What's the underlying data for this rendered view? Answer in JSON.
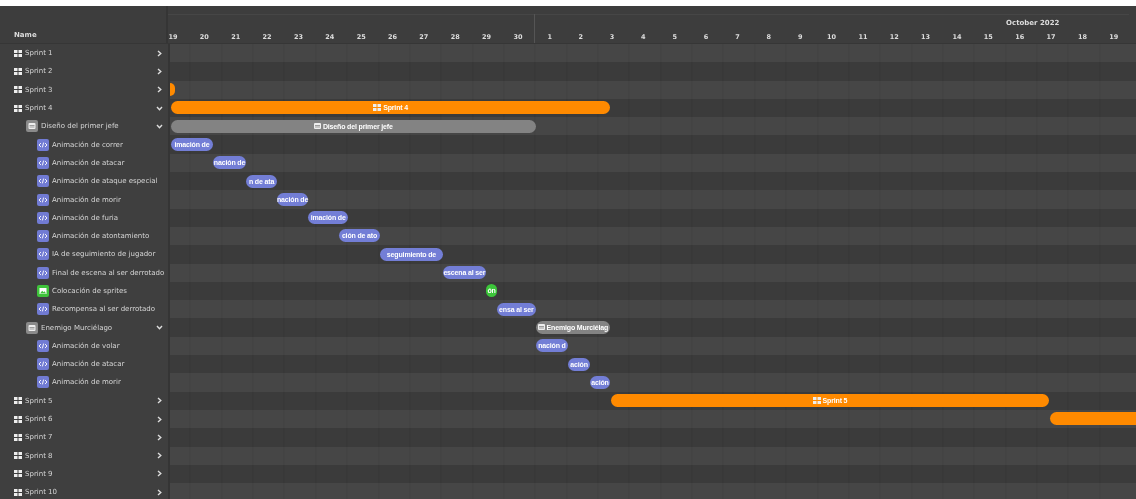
{
  "header": {
    "name_column": "Name",
    "months": [
      {
        "days": [
          "19",
          "20",
          "21",
          "22",
          "23",
          "24",
          "25",
          "26",
          "27",
          "28",
          "29",
          "30"
        ]
      },
      {
        "label": "October 2022",
        "days": [
          "1",
          "2",
          "3",
          "4",
          "5",
          "6",
          "7",
          "8",
          "9",
          "10",
          "11",
          "12",
          "13",
          "14",
          "15",
          "16",
          "17",
          "18",
          "19"
        ]
      }
    ]
  },
  "rows": [
    {
      "kind": "sprint",
      "label": "Sprint 1",
      "expanded": false,
      "has_bar": false
    },
    {
      "kind": "sprint",
      "label": "Sprint 2",
      "expanded": false,
      "has_bar": false
    },
    {
      "kind": "sprint",
      "label": "Sprint 3",
      "expanded": false,
      "has_bar": true
    },
    {
      "kind": "sprint",
      "label": "Sprint 4",
      "expanded": true,
      "has_bar": true,
      "bar_label": "Sprint 4",
      "children": [
        {
          "kind": "epic",
          "label": "Diseño del primer jefe",
          "expanded": true,
          "has_bar": true,
          "bar_label": "Diseño del primer jefe",
          "children": [
            {
              "kind": "task",
              "label": "Animación de correr",
              "has_bar": true,
              "bar_label": "imación de"
            },
            {
              "kind": "task",
              "label": "Animación de atacar",
              "has_bar": true,
              "bar_label": "nación de"
            },
            {
              "kind": "task",
              "label": "Animación de ataque especial",
              "has_bar": true,
              "bar_label": "n de ata"
            },
            {
              "kind": "task",
              "label": "Animación de morir",
              "has_bar": true,
              "bar_label": "nación de"
            },
            {
              "kind": "task",
              "label": "Animación de furia",
              "has_bar": true,
              "bar_label": "imación de"
            },
            {
              "kind": "task",
              "label": "Animación de atontamiento",
              "has_bar": true,
              "bar_label": "ción de ato"
            },
            {
              "kind": "task",
              "label": "IA de seguimiento de jugador",
              "has_bar": true,
              "bar_label": "seguimiento de"
            },
            {
              "kind": "task",
              "label": "Final de escena al ser derrotado",
              "has_bar": true,
              "bar_label": "escena al ser"
            },
            {
              "kind": "art",
              "label": "Colocación de sprites",
              "has_bar": true,
              "bar_label": "ón"
            },
            {
              "kind": "task",
              "label": "Recompensa al ser derrotado",
              "has_bar": true,
              "bar_label": "ensa al ser"
            }
          ]
        },
        {
          "kind": "epic",
          "label": "Enemigo Murciélago",
          "expanded": true,
          "has_bar": true,
          "bar_label": "Enemigo Murciélag",
          "children": [
            {
              "kind": "task",
              "label": "Animación de volar",
              "has_bar": true,
              "bar_label": "nación d"
            },
            {
              "kind": "task",
              "label": "Animación de atacar",
              "has_bar": true,
              "bar_label": "ación"
            },
            {
              "kind": "task",
              "label": "Animación de morir",
              "has_bar": true,
              "bar_label": "ación"
            }
          ]
        }
      ]
    },
    {
      "kind": "sprint",
      "label": "Sprint 5",
      "expanded": false,
      "has_bar": true,
      "bar_label": "Sprint 5"
    },
    {
      "kind": "sprint",
      "label": "Sprint 6",
      "expanded": false,
      "has_bar": true
    },
    {
      "kind": "sprint",
      "label": "Sprint 7",
      "expanded": false,
      "has_bar": false
    },
    {
      "kind": "sprint",
      "label": "Sprint 8",
      "expanded": false,
      "has_bar": false
    },
    {
      "kind": "sprint",
      "label": "Sprint 9",
      "expanded": false,
      "has_bar": false
    },
    {
      "kind": "sprint",
      "label": "Sprint 10",
      "expanded": false,
      "has_bar": false
    }
  ]
}
